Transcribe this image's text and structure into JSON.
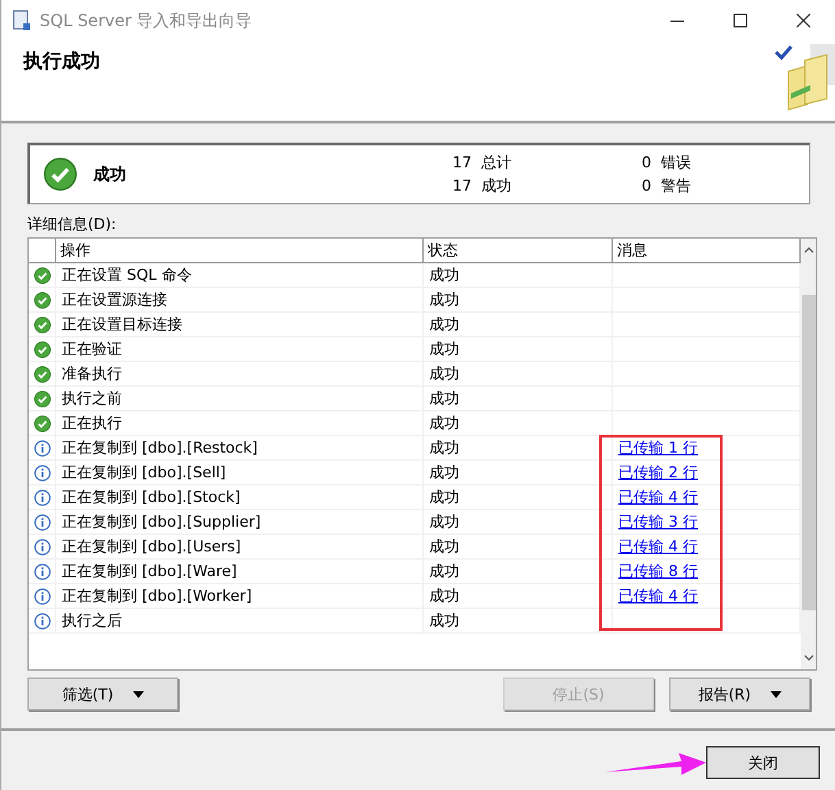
{
  "window": {
    "title": "SQL Server 导入和导出向导"
  },
  "header": {
    "title": "执行成功"
  },
  "summary": {
    "status": "成功",
    "stats": [
      {
        "count": "17",
        "label": "总计"
      },
      {
        "count": "0",
        "label": "错误"
      },
      {
        "count": "17",
        "label": "成功"
      },
      {
        "count": "0",
        "label": "警告"
      }
    ]
  },
  "details_label": "详细信息(D):",
  "table": {
    "columns": [
      "操作",
      "状态",
      "消息"
    ],
    "rows": [
      {
        "kind": "success",
        "action": "正在设置 SQL 命令",
        "status": "成功"
      },
      {
        "kind": "success",
        "action": "正在设置源连接",
        "status": "成功"
      },
      {
        "kind": "success",
        "action": "正在设置目标连接",
        "status": "成功"
      },
      {
        "kind": "success",
        "action": "正在验证",
        "status": "成功"
      },
      {
        "kind": "success",
        "action": "准备执行",
        "status": "成功"
      },
      {
        "kind": "success",
        "action": "执行之前",
        "status": "成功"
      },
      {
        "kind": "success",
        "action": "正在执行",
        "status": "成功"
      },
      {
        "kind": "info",
        "action": "正在复制到 [dbo].[Restock]",
        "status": "成功",
        "message": "已传输 1 行"
      },
      {
        "kind": "info",
        "action": "正在复制到 [dbo].[Sell]",
        "status": "成功",
        "message": "已传输 2 行"
      },
      {
        "kind": "info",
        "action": "正在复制到 [dbo].[Stock]",
        "status": "成功",
        "message": "已传输 4 行"
      },
      {
        "kind": "info",
        "action": "正在复制到 [dbo].[Supplier]",
        "status": "成功",
        "message": "已传输 3 行"
      },
      {
        "kind": "info",
        "action": "正在复制到 [dbo].[Users]",
        "status": "成功",
        "message": "已传输 4 行"
      },
      {
        "kind": "info",
        "action": "正在复制到 [dbo].[Ware]",
        "status": "成功",
        "message": "已传输 8 行"
      },
      {
        "kind": "info",
        "action": "正在复制到 [dbo].[Worker]",
        "status": "成功",
        "message": "已传输 4 行"
      },
      {
        "kind": "info",
        "action": "执行之后",
        "status": "成功"
      }
    ]
  },
  "buttons": [
    {
      "label": "筛选(T)",
      "dropdown": true,
      "disabled": false
    },
    {
      "label": "停止(S)",
      "dropdown": false,
      "disabled": true
    },
    {
      "label": "报告(R)",
      "dropdown": true,
      "disabled": false
    }
  ],
  "close_button": {
    "label": "关闭"
  }
}
